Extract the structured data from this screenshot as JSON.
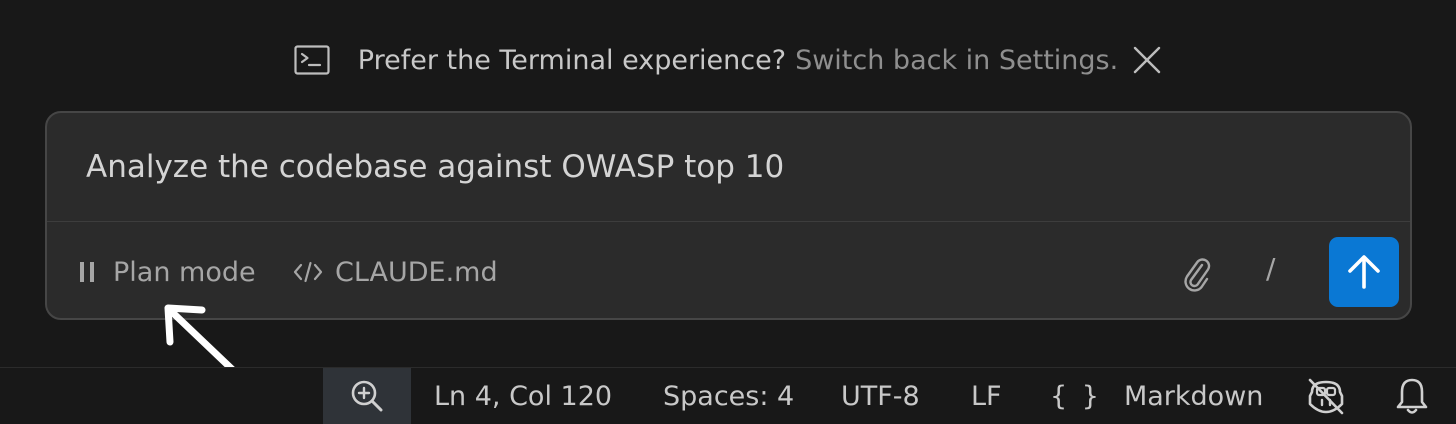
{
  "banner": {
    "icon": "terminal-icon",
    "message": "Prefer the Terminal experience?",
    "link": "Switch back in Settings.",
    "close_icon": "close-icon"
  },
  "composer": {
    "prompt_text": "Analyze the codebase against OWASP top 10",
    "mode_icon": "pause-icon",
    "mode_label": "Plan mode",
    "context_icon": "code-icon",
    "context_file": "CLAUDE.md",
    "attach_icon": "paperclip-icon",
    "slash_label": "/",
    "send_icon": "arrow-up-icon",
    "send_color": "#0a78d4"
  },
  "statusbar": {
    "zoom_icon": "zoom-in-icon",
    "position": "Ln 4, Col 120",
    "indent": "Spaces: 4",
    "encoding": "UTF-8",
    "eol": "LF",
    "language_icon": "{ }",
    "language": "Markdown",
    "copilot_icon": "copilot-disabled-icon",
    "bell_icon": "bell-icon"
  },
  "colors": {
    "background": "#181818",
    "composer_bg": "#2b2b2b",
    "accent": "#0a78d4"
  }
}
